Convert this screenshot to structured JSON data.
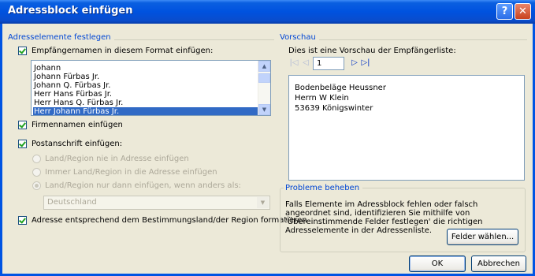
{
  "window": {
    "title": "Adressblock einfügen"
  },
  "left_group": {
    "title": "Adresselemente festlegen",
    "recipient_checkbox_label": "Empfängernamen in diesem Format einfügen:",
    "name_formats": [
      "Johann",
      "Johann Fürbas Jr.",
      "Johann Q. Fürbas Jr.",
      "Herr Hans Fürbas Jr.",
      "Herr Hans Q. Fürbas Jr.",
      "Herr Johann Fürbas Jr."
    ],
    "selected_format": "Herr Johann Fürbas Jr.",
    "company_checkbox_label": "Firmennamen einfügen",
    "postal_checkbox_label": "Postanschrift einfügen:",
    "radio_never": "Land/Region nie in Adresse einfügen",
    "radio_always": "Immer Land/Region in die Adresse einfügen",
    "radio_only_if": "Land/Region nur dann einfügen, wenn anders als:",
    "country_value": "Deutschland",
    "format_checkbox_label": "Adresse entsprechend dem Bestimmungsland/der Region formatieren"
  },
  "preview_group": {
    "title": "Vorschau",
    "caption": "Dies ist eine Vorschau der Empfängerliste:",
    "page_number": "1",
    "lines": [
      "Bodenbeläge Heussner",
      "Herrn W Klein",
      "53639 Königswinter"
    ]
  },
  "problems_group": {
    "title": "Probleme beheben",
    "text": "Falls Elemente im Adressblock fehlen oder falsch angeordnet sind, identifizieren Sie mithilfe von 'Übereinstimmende Felder festlegen' die richtigen Adresselemente in der Adressenliste.",
    "button_label": "Felder wählen..."
  },
  "footer": {
    "ok_label": "OK",
    "cancel_label": "Abbrechen"
  },
  "icons": {
    "help": "help-icon",
    "close": "close-icon",
    "first": "first-record-icon",
    "prev": "previous-record-icon",
    "next": "next-record-icon",
    "last": "last-record-icon"
  }
}
